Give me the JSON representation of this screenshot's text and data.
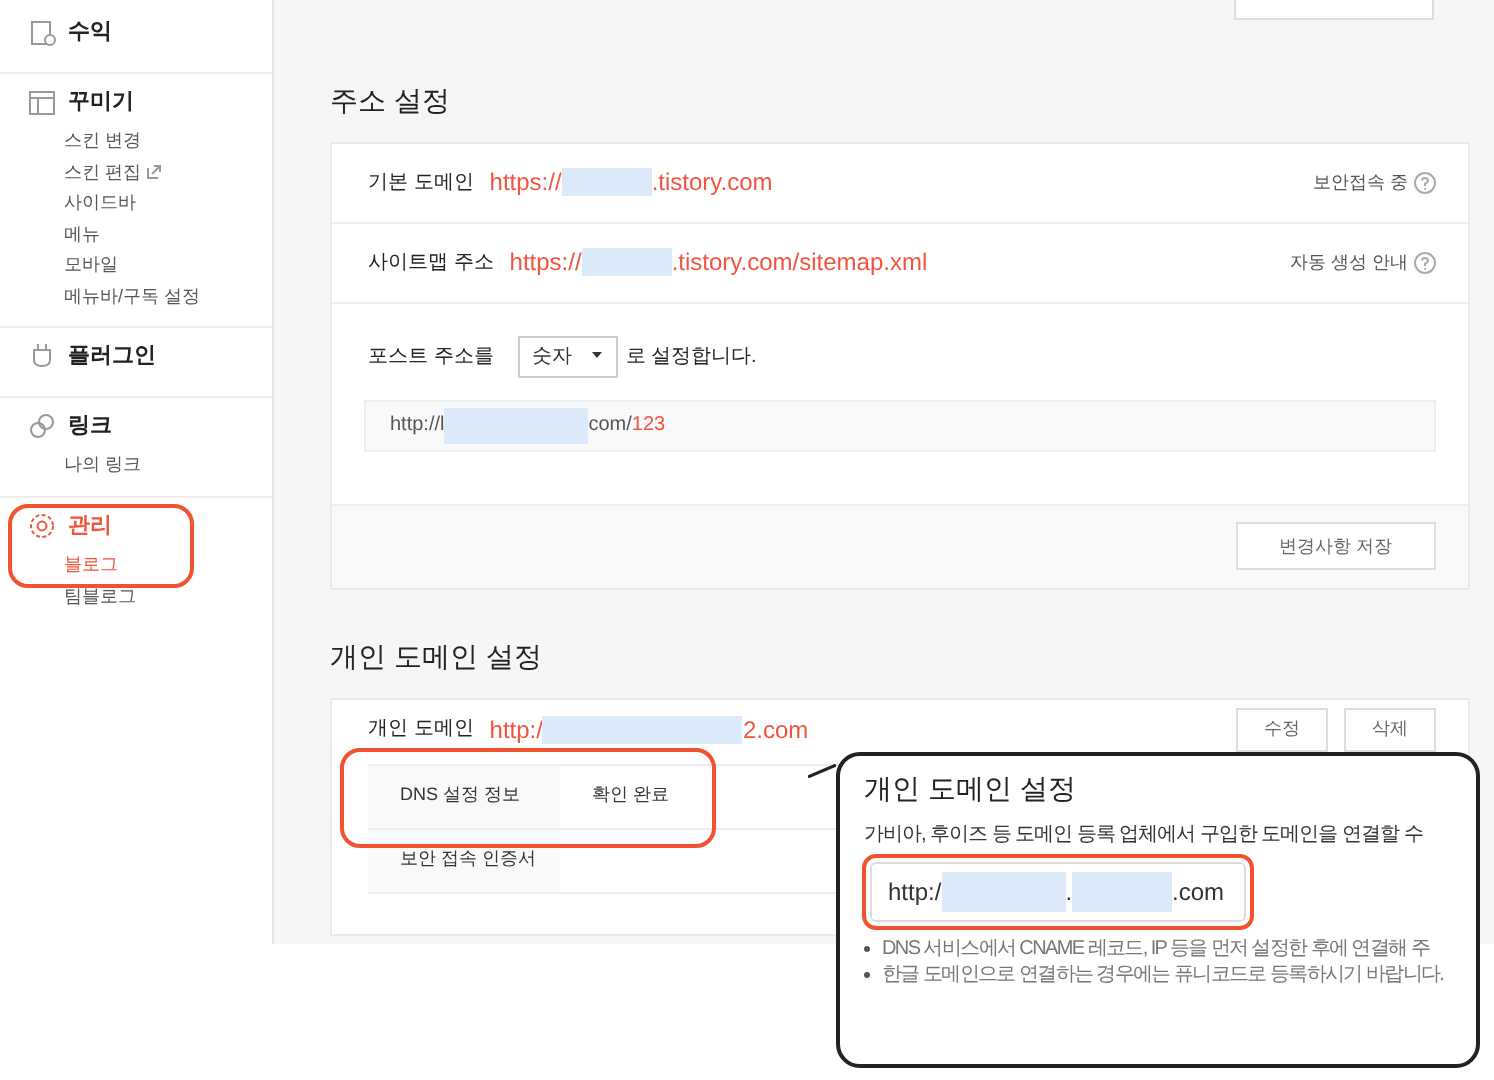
{
  "sidebar": {
    "groups": [
      {
        "title": "수익",
        "selected": false
      },
      {
        "title": "꾸미기",
        "selected": false,
        "items": [
          {
            "label": "스킨 변경",
            "selected": false,
            "external": false
          },
          {
            "label": "스킨 편집",
            "selected": false,
            "external": true
          },
          {
            "label": "사이드바",
            "selected": false,
            "external": false
          },
          {
            "label": "메뉴",
            "selected": false,
            "external": false
          },
          {
            "label": "모바일",
            "selected": false,
            "external": false
          },
          {
            "label": "메뉴바/구독 설정",
            "selected": false,
            "external": false
          }
        ]
      },
      {
        "title": "플러그인",
        "selected": false
      },
      {
        "title": "링크",
        "selected": false,
        "items": [
          {
            "label": "나의 링크",
            "selected": false,
            "external": false
          }
        ]
      },
      {
        "title": "관리",
        "selected": true,
        "items": [
          {
            "label": "블로그",
            "selected": true,
            "external": false
          },
          {
            "label": "팀블로그",
            "selected": false,
            "external": false
          }
        ]
      }
    ]
  },
  "address_settings": {
    "title": "주소 설정",
    "rows": [
      {
        "label": "기본 도메인",
        "url_start": "https://",
        "url_end": ".tistory.com",
        "note": "보안접속 중"
      },
      {
        "label": "사이트맵 주소",
        "url_start": "https://",
        "url_end": ".tistory.com/sitemap.xml",
        "note": "자동 생성 안내"
      }
    ],
    "post_address": {
      "prefix": "포스트 주소를",
      "select_value": "숫자",
      "suffix": "로 설정합니다.",
      "preview_start": "http://l",
      "preview_mid": "com/",
      "preview_end": "123"
    },
    "save_button": "변경사항 저장"
  },
  "custom_domain": {
    "title": "개인 도메인 설정",
    "label": "개인 도메인",
    "url_start": "http:/",
    "url_end": "2.com",
    "buttons": [
      "수정",
      "삭제"
    ],
    "table": [
      {
        "header": "DNS 설정 정보",
        "value": "확인 완료"
      },
      {
        "header": "보안 접속 인증서"
      }
    ]
  },
  "callout": {
    "title": "개인 도메인 설정",
    "description": "가비아, 후이즈 등 도메인 등록 업체에서 구입한 도메인을 연결할 수",
    "url_start": "http:/",
    "url_dot": ".",
    "url_end": ".com",
    "bullets": [
      "DNS 서비스에서 CNAME 레코드, IP 등을 먼저 설정한 후에 연결해 주",
      "한글 도메인으로 연결하는 경우에는 퓨니코드로 등록하시기 바랍니다."
    ]
  }
}
